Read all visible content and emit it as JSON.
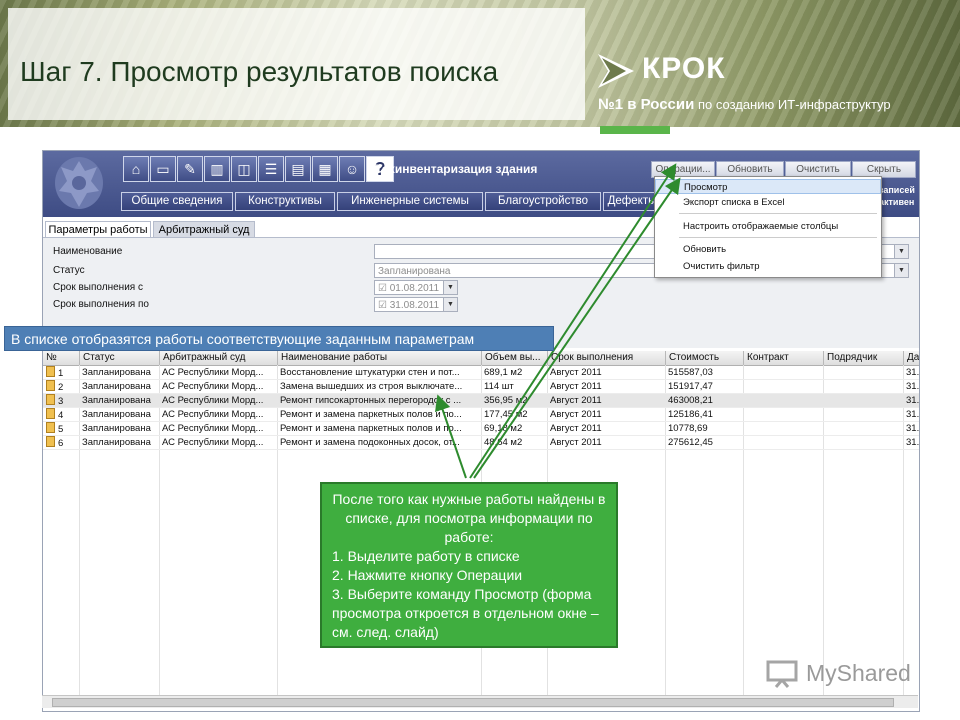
{
  "slide": {
    "title": "Шаг 7. Просмотр результатов поиска"
  },
  "logo": {
    "name": "КРОК",
    "tag_bold": "№1 в России",
    "tag_rest": " по созданию ИТ-инфраструктур"
  },
  "app": {
    "title": "Техинвентаризация здания",
    "toolbar_icons": [
      "building-icon",
      "monitor-icon",
      "tools-icon",
      "equipment-icon",
      "vehicle-icon",
      "document-icon",
      "chart-icon",
      "calendar-icon",
      "user-icon",
      "help-icon"
    ],
    "help_glyph": "?",
    "buttons": {
      "operations": "Операции...",
      "refresh": "Обновить",
      "clear": "Очистить",
      "hide": "Скрыть"
    },
    "right_note_1": "записей",
    "right_note_2": "активен",
    "nav_tabs": [
      "Общие сведения",
      "Конструктивы",
      "Инженерные системы",
      "Благоустройство",
      "Дефекты"
    ],
    "sub_tabs": [
      "Параметры работы",
      "Арбитражный суд"
    ],
    "params": {
      "name_label": "Наименование",
      "status_label": "Статус",
      "status_value": "Запланирована",
      "date_from_label": "Срок выполнения с",
      "date_from_value": "01.08.2011",
      "date_to_label": "Срок выполнения по",
      "date_to_value": "31.08.2011"
    },
    "grid": {
      "headers": [
        "№",
        "Статус",
        "Арбитражный суд",
        "Наименование работы",
        "Объем вы...",
        "Срок выполнения",
        "Стоимость",
        "Контракт",
        "Подрядчик",
        "Дат"
      ],
      "rows": [
        [
          "1",
          "Запланирована",
          "АС Республики Морд...",
          "Восстановление штукатурки стен и пот...",
          "689,1 м2",
          "Август 2011",
          "515587,03",
          "",
          "",
          "31."
        ],
        [
          "2",
          "Запланирована",
          "АС Республики Морд...",
          "Замена вышедших из строя выключате...",
          "114 шт",
          "Август 2011",
          "151917,47",
          "",
          "",
          "31."
        ],
        [
          "3",
          "Запланирована",
          "АС Республики Морд...",
          "Ремонт гипсокартонных перегородок с ...",
          "356,95 м2",
          "Август 2011",
          "463008,21",
          "",
          "",
          "31."
        ],
        [
          "4",
          "Запланирована",
          "АС Республики Морд...",
          "Ремонт и замена паркетных полов и по...",
          "177,45 м2",
          "Август 2011",
          "125186,41",
          "",
          "",
          "31."
        ],
        [
          "5",
          "Запланирована",
          "АС Республики Морд...",
          "Ремонт и замена паркетных полов и по...",
          "69,18 м2",
          "Август 2011",
          "10778,69",
          "",
          "",
          "31."
        ],
        [
          "6",
          "Запланирована",
          "АС Республики Морд...",
          "Ремонт и замена подоконных досок, от...",
          "48,64 м2",
          "Август 2011",
          "275612,45",
          "",
          "",
          "31."
        ]
      ]
    },
    "menu": {
      "items": [
        "Просмотр",
        "Экспорт списка в Excel",
        "Настроить отображаемые столбцы",
        "Обновить",
        "Очистить фильтр"
      ]
    }
  },
  "callouts": {
    "top": "В списке отобразятся работы соответствующие заданным параметрам",
    "main_intro": "После того как нужные работы найдены в списке, для посмотра информации по работе:",
    "step1": "1. Выделите работу в списке",
    "step2": "2. Нажмите кнопку Операции",
    "step3": "3. Выберите команду Просмотр (форма просмотра откроется в отдельном окне – см. след. слайд)"
  },
  "watermark": {
    "text": "MyShared"
  },
  "colors": {
    "app_header": "#3e4c84",
    "callout_blue": "#4e7fb5",
    "callout_green": "#3fae3f",
    "arrow_green": "#2e8b2e",
    "logo_accent": "#5ab54a"
  }
}
